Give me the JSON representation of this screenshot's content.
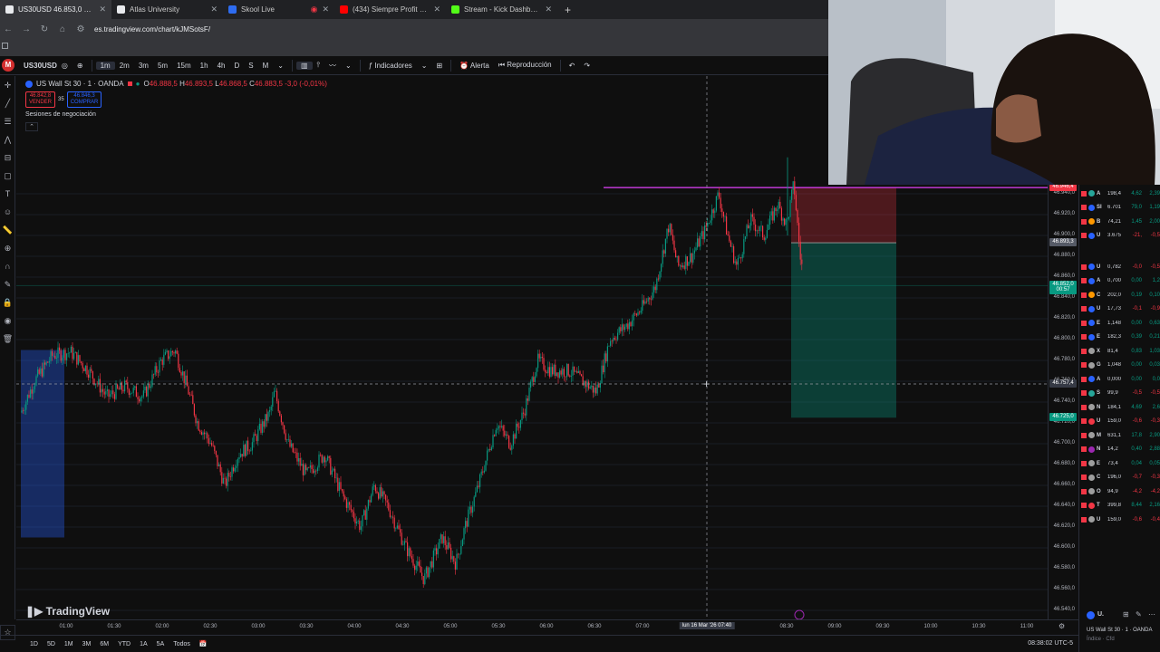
{
  "browser": {
    "tabs": [
      {
        "title": "US30USD 46.853,0 ▲ +0.79% U",
        "favicon_color": "#e8eaed",
        "active": true
      },
      {
        "title": "Atlas University",
        "favicon_color": "#e8eaed",
        "active": false
      },
      {
        "title": "Skool Live",
        "favicon_color": "#2e6cf0",
        "active": false
      },
      {
        "title": "(434) Siempre Profit - Profit | Tr",
        "favicon_color": "#ff0000",
        "active": false
      },
      {
        "title": "Stream - Kick Dashboard",
        "favicon_color": "#53fc18",
        "active": false
      }
    ],
    "url": "es.tradingview.com/chart/kJMSotsF/"
  },
  "toolbar": {
    "symbol": "US30USD",
    "intervals": [
      "1m",
      "2m",
      "3m",
      "5m",
      "15m",
      "1h",
      "4h",
      "D",
      "S",
      "M"
    ],
    "active_interval": "1m",
    "indicators": "Indicadores",
    "alert": "Alerta",
    "replay": "Reproducción"
  },
  "legend": {
    "name": "US Wall St 30 · 1 · OANDA",
    "open_label": "O",
    "open": "46.888,5",
    "high_label": "H",
    "high": "46.893,5",
    "low_label": "L",
    "low": "46.868,5",
    "close_label": "C",
    "close": "46.883,5",
    "change": "-3,0 (-0,01%)",
    "sell_price": "46.842,8",
    "sell_label": "VENDER",
    "spread": "35",
    "buy_price": "46.846,3",
    "buy_label": "COMPRAR",
    "sessions": "Sesiones de negociación"
  },
  "watermark": "TradingView",
  "price_axis": {
    "ticks": [
      "46.940,0",
      "46.920,0",
      "46.900,0",
      "46.880,0",
      "46.860,0",
      "46.840,0",
      "46.820,0",
      "46.800,0",
      "46.780,0",
      "46.760,0",
      "46.740,0",
      "46.720,0",
      "46.700,0",
      "46.680,0",
      "46.660,0",
      "46.640,0",
      "46.620,0",
      "46.600,0",
      "46.580,0",
      "46.560,0",
      "46.540,0"
    ],
    "labels": [
      {
        "text": "46.946,4",
        "color": "#f23645",
        "price": 46946.4
      },
      {
        "text": "46.893,3",
        "color": "#555a66",
        "price": 46893.3
      },
      {
        "text": "46.852,0",
        "color": "#089981",
        "price": 46852.0
      },
      {
        "text": "00:57",
        "color": "#089981",
        "price": 46847.0
      },
      {
        "text": "46.757,4",
        "color": "#363a45",
        "price": 46757.4
      },
      {
        "text": "46.725,0",
        "color": "#089981",
        "price": 46725.0
      }
    ]
  },
  "time_axis": {
    "ticks": [
      "01:00",
      "01:30",
      "02:00",
      "02:30",
      "03:00",
      "03:30",
      "04:00",
      "04:30",
      "05:00",
      "05:30",
      "06:00",
      "06:30",
      "07:00",
      "08:30",
      "09:00",
      "09:30",
      "10:00",
      "10:30",
      "11:00"
    ],
    "crosshair_label": "lun 16 Mar '26   07:40"
  },
  "bottom": {
    "ranges": [
      "1D",
      "5D",
      "1M",
      "3M",
      "6M",
      "YTD",
      "1A",
      "5A",
      "Todos"
    ],
    "clock": "08:38:02 UTC-5"
  },
  "watchlist": {
    "rows": [
      {
        "sym": "A",
        "last": "198,4",
        "chg": "4,62",
        "chgp": "2,39",
        "dir": "up",
        "dot": "#26a69a"
      },
      {
        "sym": "SI",
        "last": "6.701",
        "chg": "79,0",
        "chgp": "1,19",
        "dir": "up",
        "dot": "#2962ff"
      },
      {
        "sym": "B",
        "last": "74,21",
        "chg": "1,45",
        "chgp": "2,00",
        "dir": "up",
        "dot": "#ff9800"
      },
      {
        "sym": "U",
        "last": "3.675",
        "chg": "-21,",
        "chgp": "-0,5",
        "dir": "dn",
        "dot": "#2962ff"
      },
      {
        "sym": "U",
        "last": "0,782",
        "chg": "-0,0",
        "chgp": "-0,5",
        "dir": "dn",
        "dot": "#2962ff"
      },
      {
        "sym": "A",
        "last": "0,700",
        "chg": "0,00",
        "chgp": "1,2",
        "dir": "up",
        "dot": "#2962ff"
      },
      {
        "sym": "C",
        "last": "202,0",
        "chg": "0,19",
        "chgp": "0,10",
        "dir": "up",
        "dot": "#ff9800"
      },
      {
        "sym": "U",
        "last": "17,73",
        "chg": "-0,1",
        "chgp": "-0,9",
        "dir": "dn",
        "dot": "#2962ff"
      },
      {
        "sym": "E",
        "last": "1,148",
        "chg": "0,00",
        "chgp": "0,63",
        "dir": "up",
        "dot": "#2962ff"
      },
      {
        "sym": "E",
        "last": "182,3",
        "chg": "0,39",
        "chgp": "0,21",
        "dir": "up",
        "dot": "#2962ff"
      },
      {
        "sym": "X",
        "last": "81,4",
        "chg": "0,83",
        "chgp": "1,03",
        "dir": "up",
        "dot": "#9e9e9e"
      },
      {
        "sym": "G",
        "last": "1,048",
        "chg": "0,00",
        "chgp": "0,03",
        "dir": "up",
        "dot": "#9e9e9e"
      },
      {
        "sym": "A",
        "last": "0,000",
        "chg": "0,00",
        "chgp": "0,0",
        "dir": "up",
        "dot": "#2962ff"
      },
      {
        "sym": "S",
        "last": "99,9",
        "chg": "-0,5",
        "chgp": "-0,5",
        "dir": "dn",
        "dot": "#26a69a"
      },
      {
        "sym": "N",
        "last": "184,1",
        "chg": "4,69",
        "chgp": "2,6",
        "dir": "up",
        "dot": "#9e9e9e"
      },
      {
        "sym": "U",
        "last": "159,0",
        "chg": "-0,6",
        "chgp": "-0,3",
        "dir": "dn",
        "dot": "#f23645"
      },
      {
        "sym": "M",
        "last": "631,1",
        "chg": "17,8",
        "chgp": "2,90",
        "dir": "up",
        "dot": "#9e9e9e"
      },
      {
        "sym": "N",
        "last": "14,2",
        "chg": "0,40",
        "chgp": "2,88",
        "dir": "up",
        "dot": "#9c27b0"
      },
      {
        "sym": "E",
        "last": "73,4",
        "chg": "0,04",
        "chgp": "0,05",
        "dir": "up",
        "dot": "#9e9e9e"
      },
      {
        "sym": "C",
        "last": "196,0",
        "chg": "-0,7",
        "chgp": "-0,3",
        "dir": "dn",
        "dot": "#9e9e9e"
      },
      {
        "sym": "O",
        "last": "94,9",
        "chg": "-4,2",
        "chgp": "-4,2",
        "dir": "dn",
        "dot": "#9e9e9e"
      },
      {
        "sym": "T",
        "last": "399,8",
        "chg": "8,44",
        "chgp": "2,16",
        "dir": "up",
        "dot": "#f23645"
      },
      {
        "sym": "U",
        "last": "159,0",
        "chg": "-0,6",
        "chgp": "-0,4",
        "dir": "dn",
        "dot": "#9e9e9e"
      }
    ],
    "footer_tag": "U.",
    "footer_name": "US Wall St 30 · 1 · OANDA",
    "footer_sub": "Índice · Cfd"
  },
  "colors": {
    "up": "#089981",
    "down": "#f23645",
    "stop_zone": "rgba(242,54,69,0.28)",
    "target_zone": "rgba(8,153,129,0.35)",
    "session_box": "rgba(41,98,255,0.35)",
    "magenta_level": "#e040fb"
  }
}
